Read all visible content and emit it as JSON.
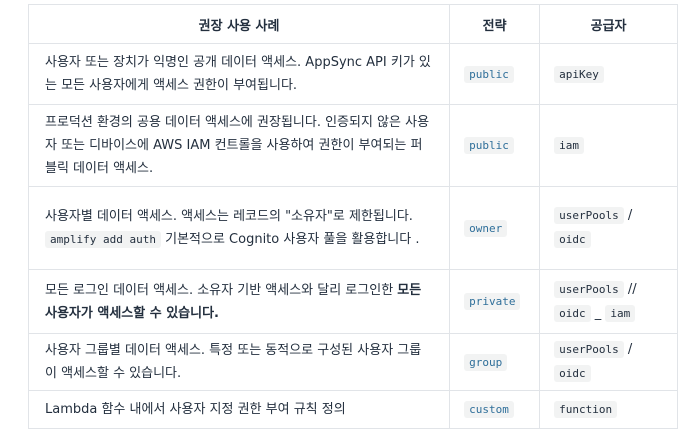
{
  "headers": {
    "use_case": "권장 사용 사례",
    "strategy": "전략",
    "provider": "공급자"
  },
  "rows": [
    {
      "description_1": "사용자 또는 장치가 익명인 공개 데이터 액세스. AppSync API 키가 있는 모든 사용자에게 액세스 권한이 부여됩니다.",
      "strategy": "public",
      "provider": "apiKey"
    },
    {
      "description_1": "프로덕션 환경의 공용 데이터 액세스에 권장됩니다. 인증되지 않은 사용자 또는 디바이스에 AWS IAM 컨트롤을 사용하여 권한이 부여되는 퍼블릭 데이터 액세스.",
      "strategy": "public",
      "provider": "iam"
    },
    {
      "description_1": "사용자별 데이터 액세스. 액세스는 레코드의 \"소유자\"로 제한됩니다.",
      "description_code": "amplify add auth",
      "description_2": "기본적으로 Cognito 사용자 풀을 활용합니다 .",
      "strategy": "owner",
      "provider_1": "userPools",
      "provider_sep": "/",
      "provider_2": "oidc"
    },
    {
      "description_1": "모든 로그인 데이터 액세스. 소유자 기반 액세스와 달리 로그인한",
      "description_bold": "모든 사용자가 액세스할 수 있습니다.",
      "strategy": "private",
      "provider_1": "userPools",
      "provider_sep": "//",
      "provider_2": "oidc",
      "provider_sep2": "_",
      "provider_3": "iam"
    },
    {
      "description_1": "사용자 그룹별 데이터 액세스. 특정 또는 동적으로 구성된 사용자 그룹이 액세스할 수 있습니다.",
      "strategy": "group",
      "provider_1": "userPools",
      "provider_sep": "/",
      "provider_2": "oidc"
    },
    {
      "description_1": "Lambda 함수 내에서 사용자 지정 권한 부여 규칙 정의",
      "strategy": "custom",
      "provider": "function"
    }
  ]
}
